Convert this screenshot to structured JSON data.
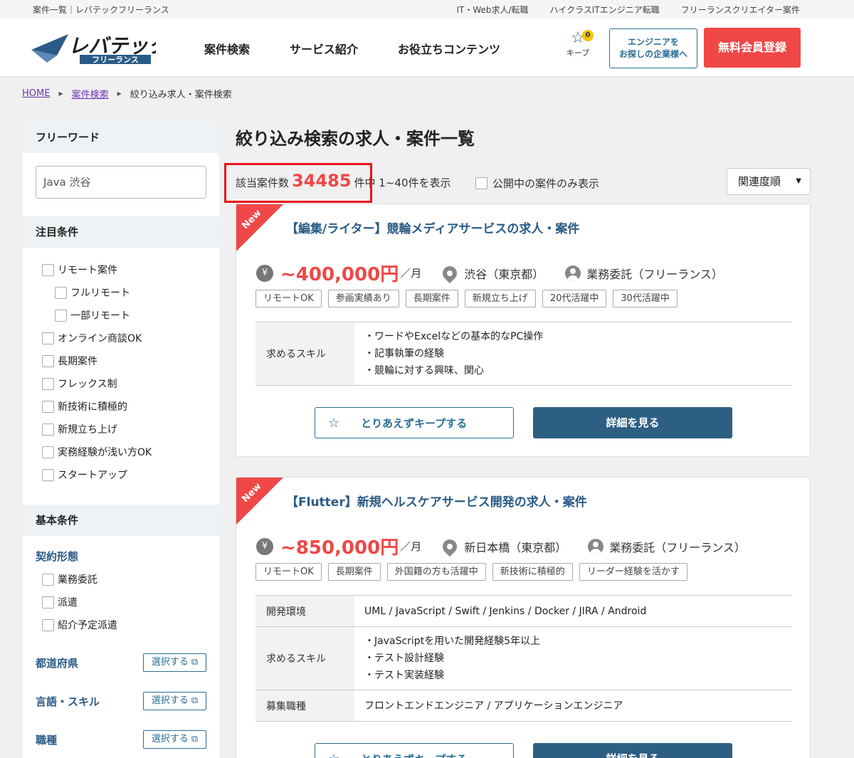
{
  "topbar": {
    "left": "案件一覧｜レバテックフリーランス",
    "links": [
      "IT・Web求人/転職",
      "ハイクラスITエンジニア転職",
      "フリーランスクリエイター案件"
    ]
  },
  "header": {
    "logo_main": "レバテック",
    "logo_sub": "フリーランス",
    "nav": [
      "案件検索",
      "サービス紹介",
      "お役立ちコンテンツ"
    ],
    "keep_label": "キープ",
    "keep_count": "0",
    "corp_button": [
      "エンジニアを",
      "お探しの企業様へ"
    ],
    "register_button": "無料会員登録"
  },
  "breadcrumb": {
    "home": "HOME",
    "search": "案件検索",
    "current": "絞り込み求人・案件検索"
  },
  "sidebar": {
    "freeword_title": "フリーワード",
    "freeword_value": "Java 渋谷",
    "focus_title": "注目条件",
    "focus_items": [
      "リモート案件",
      "フルリモート",
      "一部リモート",
      "オンライン商談OK",
      "長期案件",
      "フレックス制",
      "新技術に積極的",
      "新規立ち上げ",
      "実務経験が浅い方OK",
      "スタートアップ"
    ],
    "basic_title": "基本条件",
    "contract_title": "契約形態",
    "contract_items": [
      "業務委託",
      "派遣",
      "紹介予定派遣"
    ],
    "select_label": "選択する",
    "select_rows": [
      "都道府県",
      "言語・スキル",
      "職種"
    ]
  },
  "main": {
    "title": "絞り込み検索の求人・案件一覧",
    "count_prefix": "該当案件数",
    "count": "34485",
    "count_suffix": "件中 1~40件を表示",
    "public_only": "公開中の案件のみ表示",
    "sort": "関連度順"
  },
  "jobs": [
    {
      "badge": "New",
      "title": "【編集/ライター】競輪メディアサービスの求人・案件",
      "price": "~400,000円",
      "per": "／月",
      "location": "渋谷（東京都）",
      "contract": "業務委託（フリーランス）",
      "tags": [
        "リモートOK",
        "参画実績あり",
        "長期案件",
        "新規立ち上げ",
        "20代活躍中",
        "30代活躍中"
      ],
      "skills_label": "求めるスキル",
      "skills": [
        "・ワードやExcelなどの基本的なPC操作",
        "・記事執筆の経験",
        "・競輪に対する興味、関心"
      ],
      "keep_button": "とりあえずキープする",
      "detail_button": "詳細を見る"
    },
    {
      "badge": "New",
      "title": "【Flutter】新規ヘルスケアサービス開発の求人・案件",
      "price": "~850,000円",
      "per": "／月",
      "location": "新日本橋（東京都）",
      "contract": "業務委託（フリーランス）",
      "tags": [
        "リモートOK",
        "長期案件",
        "外国籍の方も活躍中",
        "新技術に積極的",
        "リーダー経験を活かす"
      ],
      "env_label": "開発環境",
      "env": "UML / JavaScript / Swift / Jenkins / Docker / JIRA / Android",
      "skills_label": "求めるスキル",
      "skills": [
        "・JavaScriptを用いた開発経験5年以上",
        "・テスト設計経験",
        "・テスト実装経験"
      ],
      "role_label": "募集職種",
      "role": "フロントエンドエンジニア / アプリケーションエンジニア",
      "keep_button": "とりあえずキープする",
      "detail_button": "詳細を見る"
    }
  ],
  "colors": {
    "accent_red": "#f04747",
    "brand_blue": "#2a5b86",
    "highlight_box": "#e8131b"
  }
}
